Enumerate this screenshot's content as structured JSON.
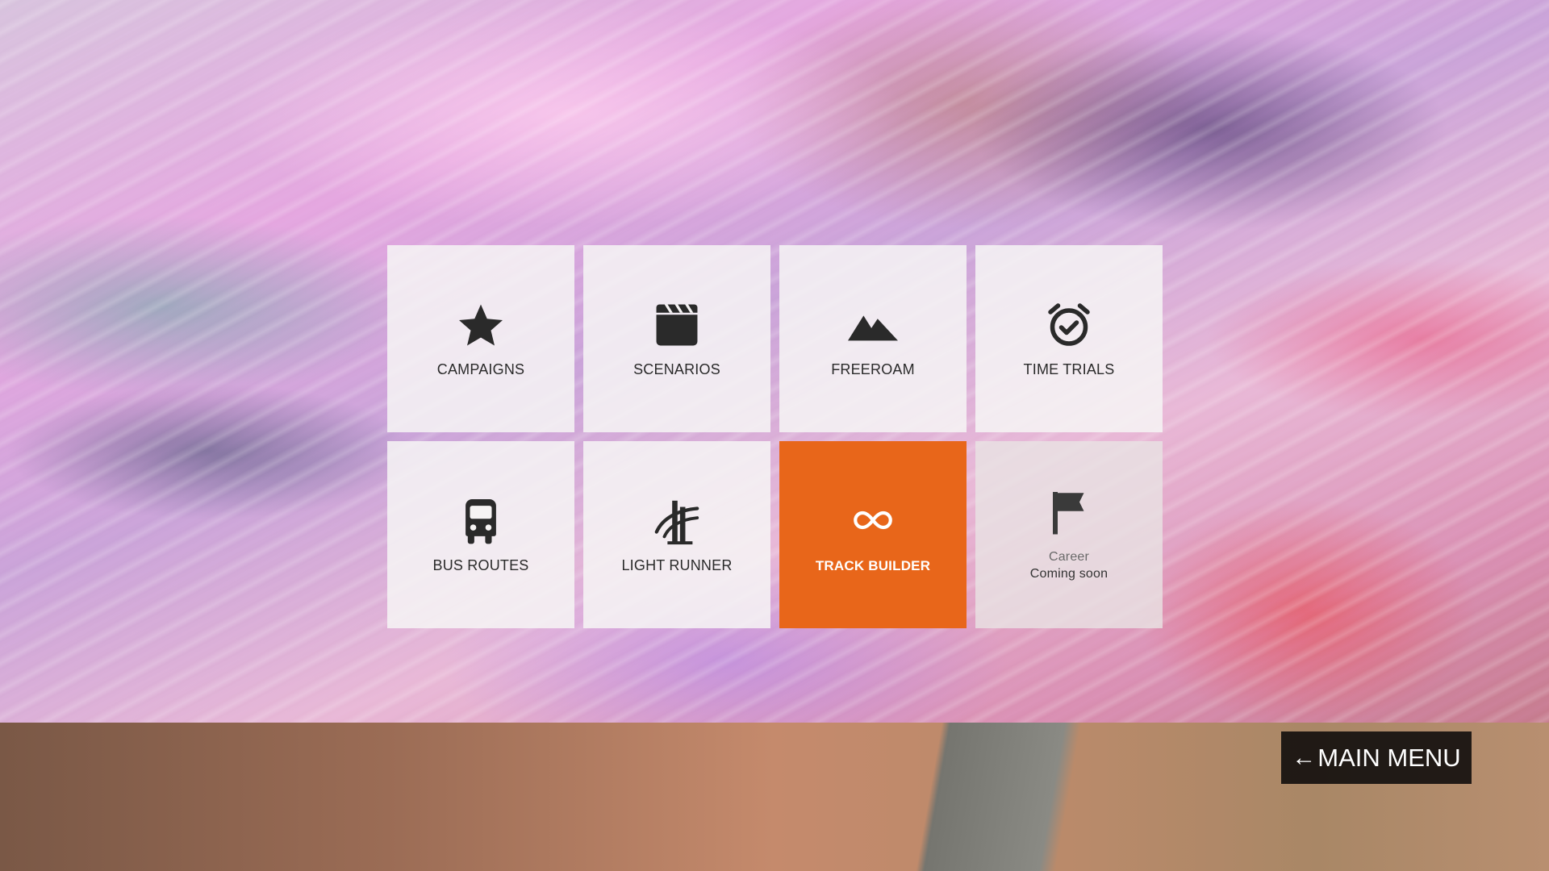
{
  "menu": {
    "tiles": [
      {
        "label": "CAMPAIGNS",
        "icon": "star-icon"
      },
      {
        "label": "SCENARIOS",
        "icon": "clapperboard-icon"
      },
      {
        "label": "FREEROAM",
        "icon": "mountains-icon"
      },
      {
        "label": "TIME TRIALS",
        "icon": "alarm-clock-check-icon"
      },
      {
        "label": "BUS ROUTES",
        "icon": "bus-icon"
      },
      {
        "label": "LIGHT RUNNER",
        "icon": "light-runner-icon"
      },
      {
        "label": "TRACK BUILDER",
        "icon": "infinity-icon",
        "selected": true
      },
      {
        "label": "Career",
        "sublabel": "Coming soon",
        "icon": "flag-icon",
        "disabled": true
      }
    ]
  },
  "back_button": {
    "arrow": "←",
    "label": "MAIN MENU"
  },
  "colors": {
    "tile_background": "#f6f4f4",
    "selected_tile": "#e8661a",
    "icon": "#2a2a2a",
    "back_button_background": "#0c0a0a"
  }
}
